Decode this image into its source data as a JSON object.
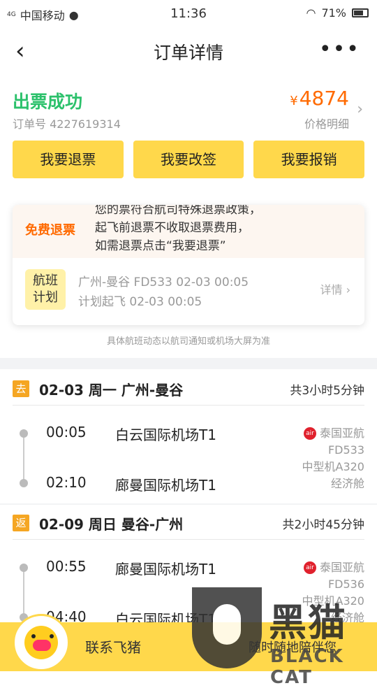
{
  "status_bar": {
    "network": "4G",
    "carrier": "中国移动",
    "time": "11:36",
    "battery": "71%"
  },
  "nav": {
    "back_icon": "chevron-left-icon",
    "title": "订单详情",
    "more_icon": "more-dots-icon"
  },
  "order": {
    "status": "出票成功",
    "order_no": "订单号 4227619314",
    "currency": "¥",
    "price": "4874",
    "price_detail": "价格明细"
  },
  "actions": {
    "refund": "我要退票",
    "change": "我要改签",
    "reimburse": "我要报销"
  },
  "refund_card": {
    "tag": "免费退票",
    "lines": [
      "您的票符合航司特殊退票政策，",
      "起飞前退票不收取退票费用，",
      "如需退票点击“我要退票”"
    ],
    "flight_badge_l1": "航班",
    "flight_badge_l2": "计划",
    "flight_info": "广州-曼谷 FD533 02-03 00:05",
    "planned": "计划起飞 02-03 00:05",
    "detail": "详情"
  },
  "note": "具体航班动态以航司通知或机场大屏为准",
  "trips": [
    {
      "badge": "去",
      "route": "02-03 周一 广州-曼谷",
      "duration": "共3小时5分钟",
      "dep_time": "00:05",
      "dep_airport": "白云国际机场T1",
      "arr_time": "02:10",
      "arr_airport": "廊曼国际机场T1",
      "airline": "泰国亚航",
      "flight": "FD533",
      "aircraft": "中型机A320",
      "cabin": "经济舱"
    },
    {
      "badge": "返",
      "route": "02-09 周日 曼谷-广州",
      "duration": "共2小时45分钟",
      "dep_time": "00:55",
      "dep_airport": "廊曼国际机场T1",
      "arr_time": "04:40",
      "arr_airport": "白云国际机场T1",
      "airline": "泰国亚航",
      "flight": "FD536",
      "aircraft": "中型机A320",
      "cabin": "经济舱"
    }
  ],
  "bottom": {
    "contact": "联系飞猪",
    "slogan": "随时随地陪伴您"
  },
  "watermark": {
    "cn": "黑猫",
    "en": "BLACK CAT"
  },
  "colors": {
    "accent": "#ffd84b",
    "success": "#2bc16b",
    "price": "#ff6a00"
  }
}
